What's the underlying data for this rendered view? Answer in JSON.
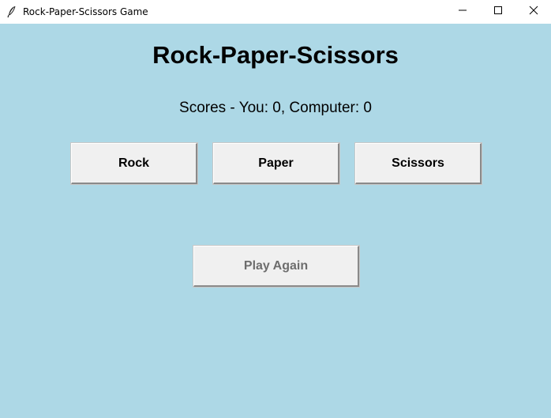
{
  "window": {
    "title": "Rock-Paper-Scissors Game",
    "app_icon": "feather-icon",
    "controls": {
      "minimize_icon": "minimize-icon",
      "maximize_icon": "maximize-icon",
      "close_icon": "close-icon"
    }
  },
  "main": {
    "heading": "Rock-Paper-Scissors",
    "scores_text": "Scores - You: 0, Computer: 0",
    "choices": {
      "rock_label": "Rock",
      "paper_label": "Paper",
      "scissors_label": "Scissors"
    },
    "play_again_label": "Play Again",
    "play_again_enabled": false
  },
  "colors": {
    "background": "#add8e6",
    "button_face": "#f0f0f0",
    "disabled_text": "#6d6d6d"
  }
}
